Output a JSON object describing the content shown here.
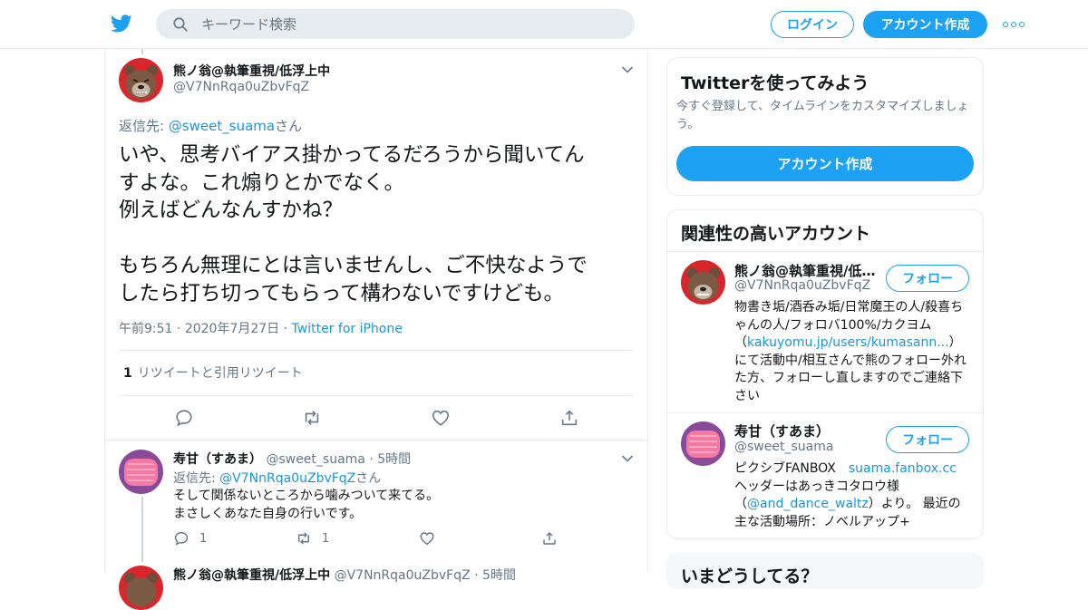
{
  "header": {
    "search_placeholder": "キーワード検索",
    "login_label": "ログイン",
    "signup_label": "アカウント作成",
    "logo_icon": "twitter-bird-icon",
    "accent_color": "#1da1f2"
  },
  "main_tweet": {
    "display_name": "熊ノ翁@執筆重視/低浮上中",
    "handle": "@V7NnRqa0uZbvFqZ",
    "reply_prefix": "返信先: ",
    "reply_to_handle": "@sweet_suama",
    "reply_suffix": "さん",
    "text": "いや、思考バイアス掛かってるだろうから聞いてん\nすよな。これ煽りとかでなく。\n例えばどんなんすかね？\n\nもちろん無理にとは言いませんし、ご不快なようで\nしたら打ち切ってもらって構わないですけども。",
    "time": "午前9:51",
    "date": "2020年7月27日",
    "source": "Twitter for iPhone",
    "separator": "·",
    "retweet_count": "1",
    "retweet_label": "リツイートと引用リツイート"
  },
  "reply_tweet": {
    "display_name": "寿甘（すあま）",
    "handle": "@sweet_suama",
    "separator": "·",
    "time_ago": "5時間",
    "reply_prefix": "返信先: ",
    "reply_to_handle": "@V7NnRqa0uZbvFqZ",
    "reply_suffix": "さん",
    "text": "そして関係ないところから噛みついて来てる。\nまさしくあなた自身の行いです。",
    "reply_count": "1",
    "retweet_count": "1"
  },
  "next_tweet": {
    "display_name": "熊ノ翁@執筆重視/低浮上中",
    "handle": "@V7NnRqa0uZbvFqZ",
    "time_ago": "5時間"
  },
  "sidebar": {
    "try_card": {
      "title": "Twitterを使ってみよう",
      "description": "今すぐ登録して、タイムラインをカスタマイズしましょう。",
      "button_label": "アカウント作成"
    },
    "related_card": {
      "title": "関連性の高いアカウント",
      "follow_label": "フォロー",
      "accounts": [
        {
          "name": "熊ノ翁@執筆重視/低浮上中",
          "handle": "@V7NnRqa0uZbvFqZ",
          "bio_1": "物書き垢/酒呑み垢/日常魔王の人/殺喜ちゃんの人/フォロバ100%/カクヨム（",
          "bio_link": "kakuyomu.jp/users/kumasann...",
          "bio_2": "）にて活動中/相互さんで熊のフォロー外れた方、フォローし直しますのでご連絡下さい"
        },
        {
          "name": "寿甘（すあま）",
          "handle": "@sweet_suama",
          "bio_1": "ピクシブFANBOX　",
          "bio_link": "suama.fanbox.cc",
          "bio_2": "ヘッダーはあっきコタロウ様（",
          "bio_link_2": "@and_dance_waltz",
          "bio_3": "）より。 最近の主な活動場所：ノベルアップ+"
        }
      ]
    },
    "trend_card_title": "いまどうしてる？"
  }
}
